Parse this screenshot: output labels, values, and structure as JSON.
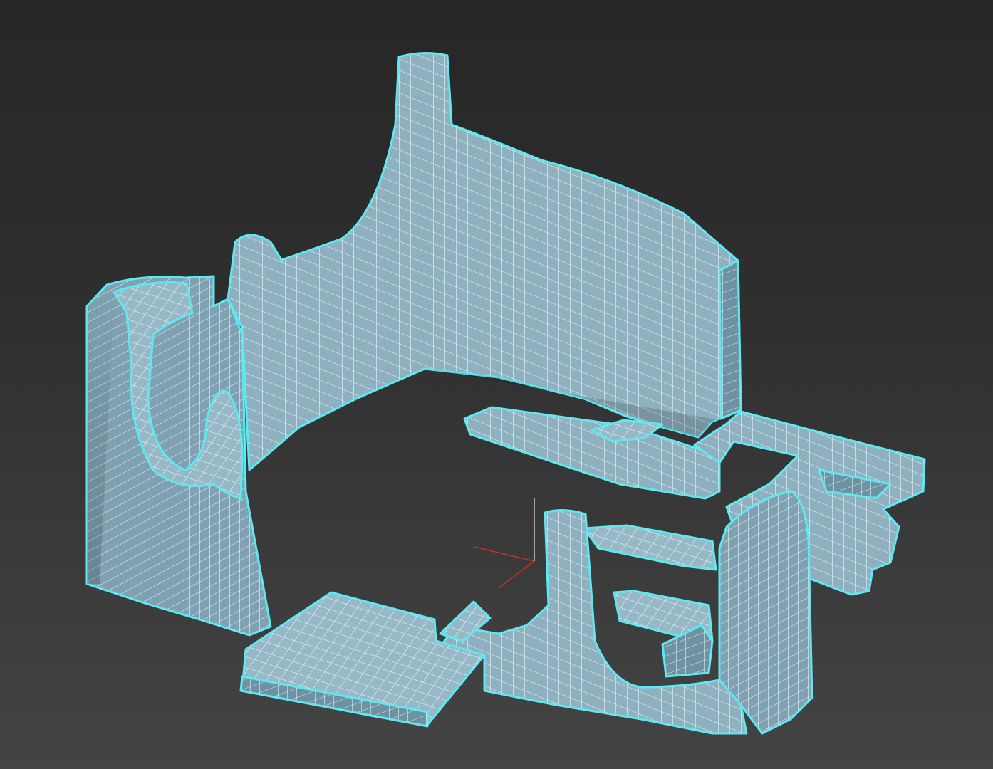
{
  "viewport": {
    "background_top": "#262626",
    "background_bottom": "#444444"
  },
  "model": {
    "type": "quad-wireframe mesh over shaded surface",
    "surface_color": "#8fb0bf",
    "surface_shadow_color": "#6e8c9b",
    "wire_color": "#dff3f7",
    "selection_outline_color": "#5ee8f0"
  },
  "gizmo": {
    "x_axis_color": "#c8302c",
    "z_axis_color": "#c9c9c9"
  }
}
